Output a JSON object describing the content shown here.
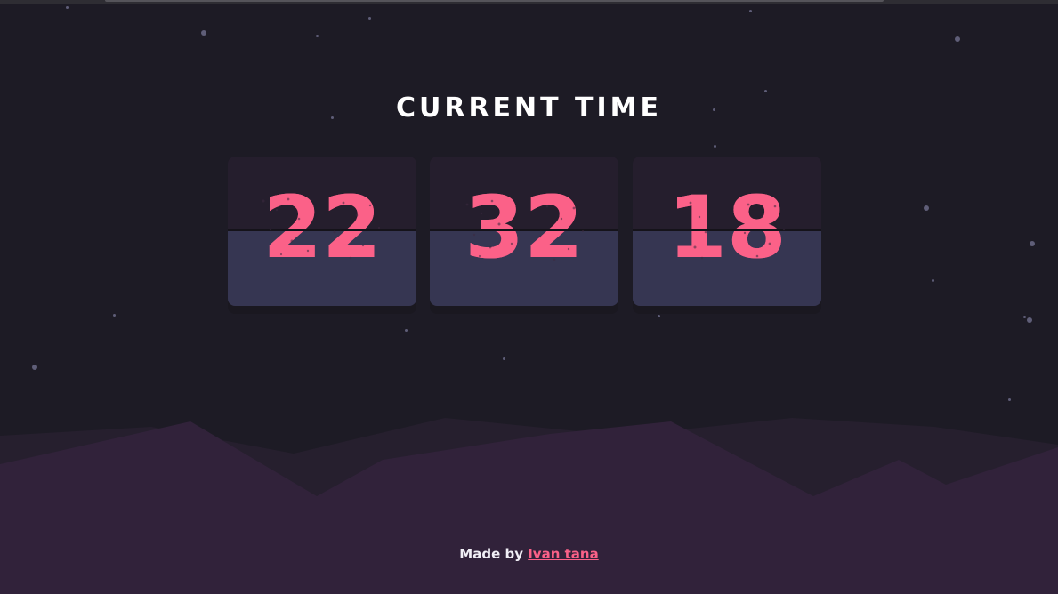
{
  "title": "CURRENT TIME",
  "clock": {
    "hours": "22",
    "minutes": "32",
    "seconds": "18"
  },
  "footer": {
    "prefix": "Made by",
    "author": "Ivan tana"
  },
  "colors": {
    "background": "#1d1b25",
    "digit": "#fb6188",
    "card_top": "#251e2d",
    "card_bottom": "#363652",
    "hills": "#32233a",
    "title": "#ffffff"
  }
}
